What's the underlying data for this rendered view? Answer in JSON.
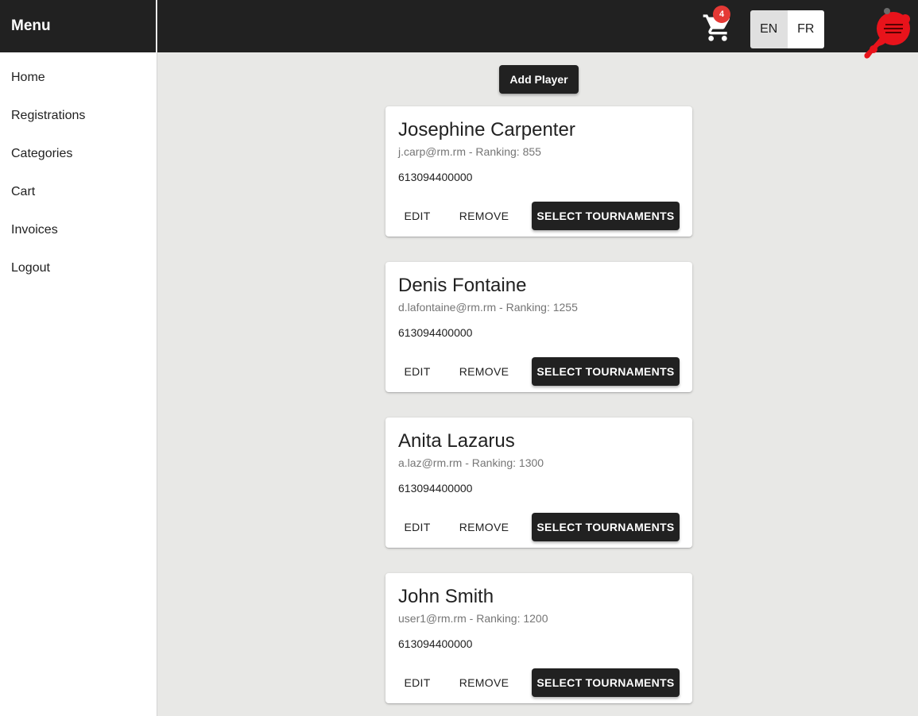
{
  "sidebar": {
    "title": "Menu",
    "items": [
      {
        "label": "Home"
      },
      {
        "label": "Registrations"
      },
      {
        "label": "Categories"
      },
      {
        "label": "Cart"
      },
      {
        "label": "Invoices"
      },
      {
        "label": "Logout"
      }
    ]
  },
  "topbar": {
    "cart_icon": "shopping-cart-icon",
    "cart_count": "4",
    "languages": [
      {
        "label": "EN",
        "selected": true
      },
      {
        "label": "FR",
        "selected": false
      }
    ],
    "logo_icon": "red-splash-logo"
  },
  "main": {
    "add_player_label": "Add Player",
    "players": [
      {
        "name": "Josephine Carpenter",
        "subtitle": "j.carp@rm.rm - Ranking: 855",
        "phone": "613094400000"
      },
      {
        "name": "Denis Fontaine",
        "subtitle": "d.lafontaine@rm.rm - Ranking: 1255",
        "phone": "613094400000"
      },
      {
        "name": "Anita Lazarus",
        "subtitle": "a.laz@rm.rm - Ranking: 1300",
        "phone": "613094400000"
      },
      {
        "name": "John Smith",
        "subtitle": "user1@rm.rm - Ranking: 1200",
        "phone": "613094400000"
      }
    ],
    "actions": {
      "edit": "EDIT",
      "remove": "REMOVE",
      "select": "SELECT TOURNAMENTS"
    }
  },
  "colors": {
    "dark": "#212121",
    "background": "#e8e8e6",
    "badge": "#e53935",
    "logo_red": "#e8131b"
  }
}
